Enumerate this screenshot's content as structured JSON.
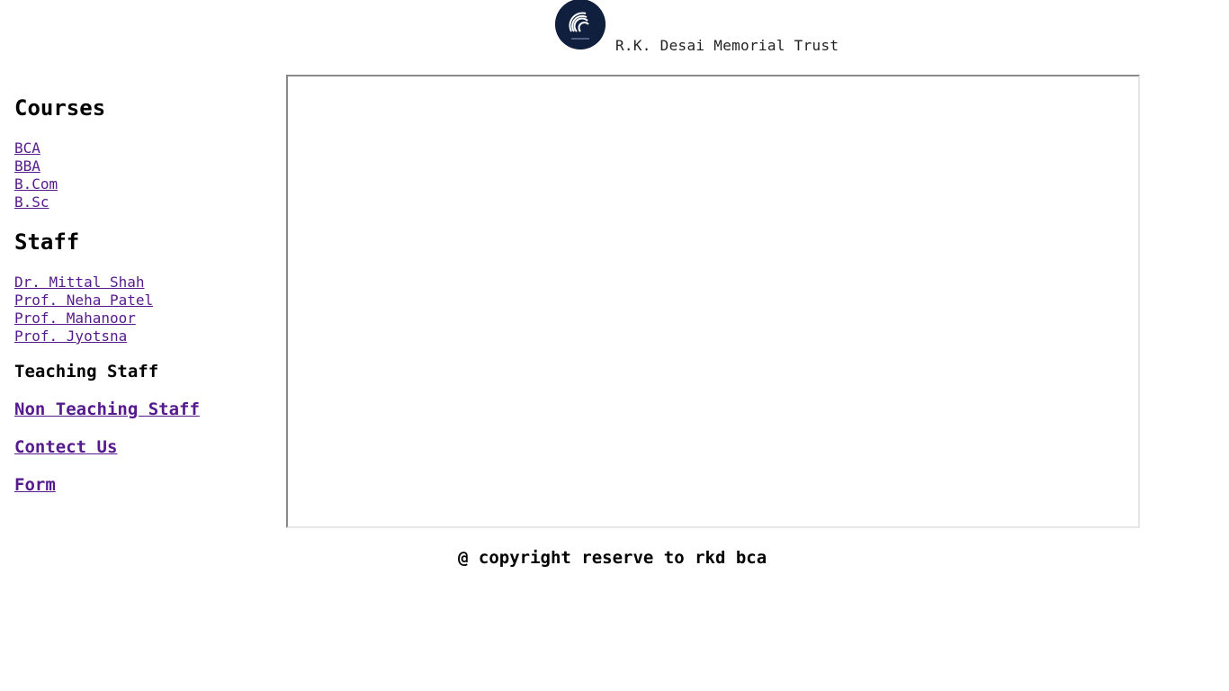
{
  "header": {
    "logo_icon": "college-logo",
    "trust_name": "R.K. Desai Memorial Trust"
  },
  "sidebar": {
    "courses_heading": "Courses",
    "courses": [
      "BCA",
      "BBA",
      "B.Com",
      "B.Sc"
    ],
    "staff_heading": "Staff",
    "staff": [
      "Dr. Mittal Shah",
      "Prof. Neha Patel",
      "Prof. Mahanoor",
      "Prof. Jyotsna"
    ],
    "teaching_staff": "Teaching Staff",
    "non_teaching_staff": "Non Teaching Staff",
    "contact_us": "Contect Us",
    "form": "Form"
  },
  "footer": {
    "copyright": "@ copyright reserve to rkd bca"
  },
  "colors": {
    "link": "#551a8b",
    "logo_bg": "#0f1f3d"
  }
}
